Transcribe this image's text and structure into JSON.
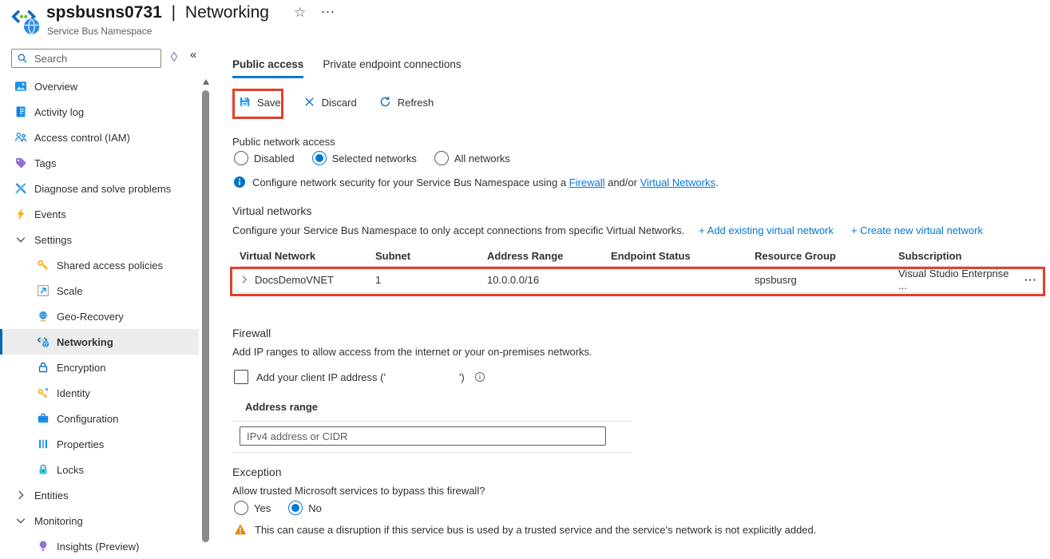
{
  "header": {
    "resource_name": "spsbusns0731",
    "title_pipe": "|",
    "page_name": "Networking",
    "subtitle": "Service Bus Namespace",
    "star_icon": "☆",
    "more_icon": "…"
  },
  "sidebar": {
    "search_placeholder": "Search",
    "collapse_icon": "«",
    "items": [
      {
        "label": "Overview",
        "icon": "overview",
        "indent": false
      },
      {
        "label": "Activity log",
        "icon": "activity-log",
        "indent": false
      },
      {
        "label": "Access control (IAM)",
        "icon": "access-control",
        "indent": false
      },
      {
        "label": "Tags",
        "icon": "tags",
        "indent": false
      },
      {
        "label": "Diagnose and solve problems",
        "icon": "diagnose",
        "indent": false
      },
      {
        "label": "Events",
        "icon": "events",
        "indent": false
      },
      {
        "label": "Settings",
        "chevron": "down",
        "indent": false,
        "group": true
      },
      {
        "label": "Shared access policies",
        "icon": "key",
        "indent": true
      },
      {
        "label": "Scale",
        "icon": "scale",
        "indent": true
      },
      {
        "label": "Geo-Recovery",
        "icon": "geo-recovery",
        "indent": true
      },
      {
        "label": "Networking",
        "icon": "service-bus",
        "indent": true,
        "selected": true
      },
      {
        "label": "Encryption",
        "icon": "encryption",
        "indent": true
      },
      {
        "label": "Identity",
        "icon": "identity",
        "indent": true
      },
      {
        "label": "Configuration",
        "icon": "configuration",
        "indent": true
      },
      {
        "label": "Properties",
        "icon": "properties",
        "indent": true
      },
      {
        "label": "Locks",
        "icon": "locks",
        "indent": true
      },
      {
        "label": "Entities",
        "chevron": "right",
        "indent": false,
        "group": true
      },
      {
        "label": "Monitoring",
        "chevron": "down",
        "indent": false,
        "group": true
      },
      {
        "label": "Insights (Preview)",
        "icon": "insights",
        "indent": true
      }
    ]
  },
  "main": {
    "tabs": [
      {
        "label": "Public access",
        "active": true
      },
      {
        "label": "Private endpoint connections",
        "active": false
      }
    ],
    "toolbar": [
      {
        "label": "Save",
        "icon": "save"
      },
      {
        "label": "Discard",
        "icon": "discard"
      },
      {
        "label": "Refresh",
        "icon": "refresh"
      }
    ],
    "public_network_access": {
      "label": "Public network access",
      "options": [
        "Disabled",
        "Selected networks",
        "All networks"
      ],
      "selected": "Selected networks"
    },
    "info_note": {
      "prefix": "Configure network security for your Service Bus Namespace using a ",
      "firewall_link": "Firewall",
      "connector": " and/or ",
      "vnet_link": "Virtual Networks",
      "suffix": "."
    },
    "virtual_networks": {
      "heading": "Virtual networks",
      "description": "Configure your Service Bus Namespace to only accept connections from specific Virtual Networks.",
      "add_existing_link": "+ Add existing virtual network",
      "create_new_link": "+ Create new virtual network",
      "table": {
        "headers": [
          "Virtual Network",
          "Subnet",
          "Address Range",
          "Endpoint Status",
          "Resource Group",
          "Subscription"
        ],
        "rows": [
          {
            "virtual_network": "DocsDemoVNET",
            "subnet": "1",
            "address_range": "10.0.0.0/16",
            "endpoint_status": "",
            "resource_group": "spsbusrg",
            "subscription": "Visual Studio Enterprise ...",
            "menu": "···"
          }
        ]
      }
    },
    "firewall": {
      "heading": "Firewall",
      "description": "Add IP ranges to allow access from the internet or your on-premises networks.",
      "client_ip_label_before": "Add your client IP address ('",
      "client_ip_label_after": "')",
      "checkbox_checked": false,
      "address_range_label": "Address range",
      "input_placeholder": "IPv4 address or CIDR"
    },
    "exception": {
      "heading": "Exception",
      "question": "Allow trusted Microsoft services to bypass this firewall?",
      "options": [
        "Yes",
        "No"
      ],
      "selected": "No",
      "warning": "This can cause a disruption if this service bus is used by a trusted service and the service's network is not explicitly added."
    }
  },
  "colors": {
    "accent": "#0078d4",
    "link": "#0078d4",
    "highlight_box": "#e2402d",
    "warning_icon": "#e08700",
    "selected_item_bg": "#ececec"
  }
}
